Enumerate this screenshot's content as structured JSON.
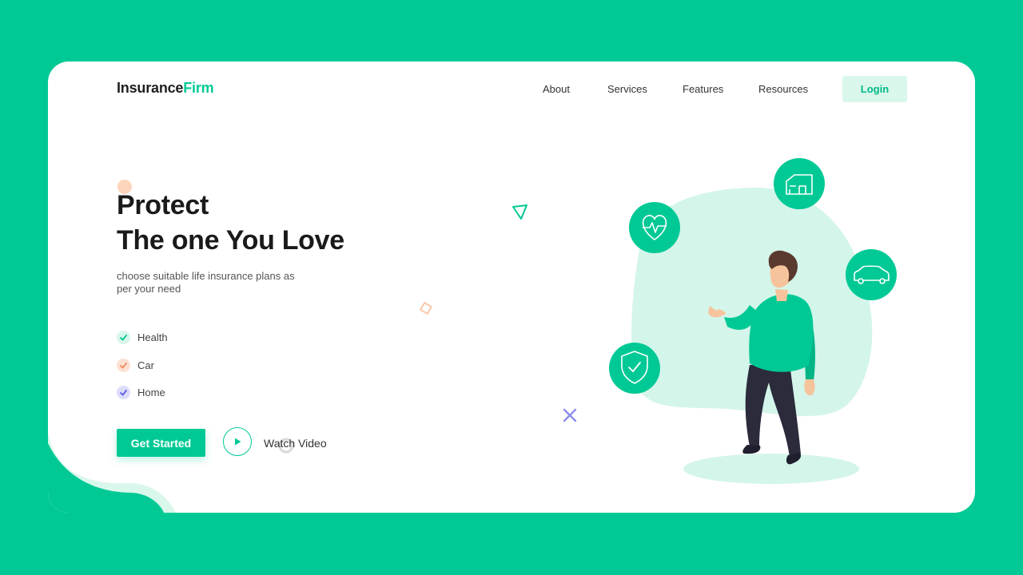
{
  "brand": {
    "name_part1": "Insurance",
    "name_part2": "Firm"
  },
  "nav": {
    "items": [
      {
        "label": "About"
      },
      {
        "label": "Services"
      },
      {
        "label": "Features"
      },
      {
        "label": "Resources"
      }
    ],
    "login_label": "Login"
  },
  "hero": {
    "headline_line1": "Protect",
    "headline_line2": "The one You Love",
    "subtitle": "choose suitable life insurance plans as per your need",
    "features": [
      {
        "label": "Health",
        "icon": "check-icon",
        "color": "#00c995",
        "bg": "#d9f7ea"
      },
      {
        "label": "Car",
        "icon": "check-icon",
        "color": "#f08a5d",
        "bg": "#fde1d2"
      },
      {
        "label": "Home",
        "icon": "check-icon",
        "color": "#5b5fe8",
        "bg": "#dcdcfb"
      }
    ],
    "cta_label": "Get Started",
    "watch_label": "Watch Video"
  },
  "illustration": {
    "icons": [
      "house-icon",
      "heartbeat-icon",
      "car-icon",
      "shield-check-icon"
    ]
  },
  "colors": {
    "accent": "#00c995",
    "accent_light": "#d4f5ea"
  }
}
